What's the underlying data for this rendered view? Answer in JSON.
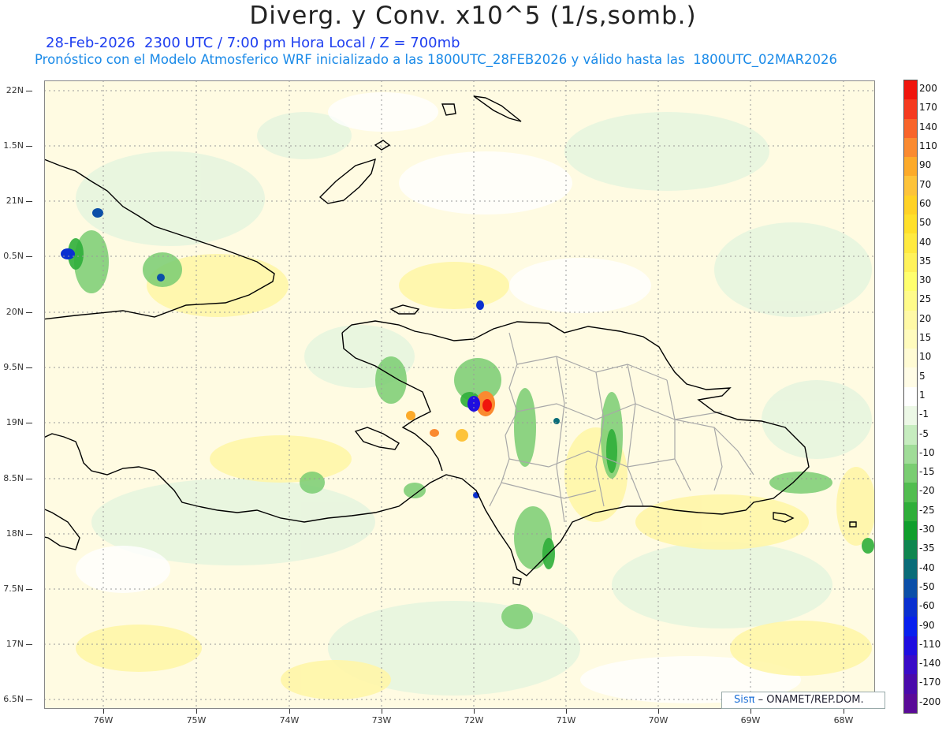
{
  "header": {
    "title": "Diverg. y Conv. x10^5 (1/s,somb.)",
    "line1": "28-Feb-2026  2300 UTC / 7:00 pm Hora Local / Z = 700mb",
    "line2": "Pronóstico con el Modelo Atmosferico WRF inicializado a las 1800UTC_28FEB2026 y válido hasta las  1800UTC_02MAR2026"
  },
  "axes": {
    "lat_labels": [
      "22N",
      "1.5N",
      "21N",
      "0.5N",
      "20N",
      "9.5N",
      "19N",
      "8.5N",
      "18N",
      "7.5N",
      "17N",
      "6.5N"
    ],
    "lon_labels": [
      "76W",
      "75W",
      "74W",
      "73W",
      "72W",
      "71W",
      "70W",
      "69W",
      "68W"
    ]
  },
  "legend": {
    "labels": [
      "200",
      "170",
      "140",
      "110",
      "90",
      "70",
      "60",
      "50",
      "40",
      "35",
      "30",
      "25",
      "20",
      "15",
      "10",
      "5",
      "1",
      "-1",
      "-5",
      "-10",
      "-15",
      "-20",
      "-25",
      "-30",
      "-35",
      "-40",
      "-50",
      "-60",
      "-90",
      "-110",
      "-140",
      "-170",
      "-200"
    ],
    "colors": [
      "#f0150d",
      "#f53a1f",
      "#f8642a",
      "#fa8a30",
      "#fcaa2a",
      "#fdc33a",
      "#ffd225",
      "#ffe02a",
      "#ffea40",
      "#fff25a",
      "#ffff6e",
      "#fffb8a",
      "#fff9a6",
      "#fffbbd",
      "#fffbd4",
      "#fffce6",
      "#ffffff",
      "#ecf8e6",
      "#c6ecbf",
      "#a0dc98",
      "#7acd72",
      "#52bd50",
      "#2fae3a",
      "#109e2d",
      "#0f8650",
      "#0a6c78",
      "#0b4fa8",
      "#0a30d0",
      "#0820ee",
      "#1f0ee0",
      "#3a0cc8",
      "#4a0bab",
      "#5a0b98"
    ]
  },
  "credit": {
    "sis": "Sisπ",
    "text": "– ONAMET/REP.DOM."
  }
}
